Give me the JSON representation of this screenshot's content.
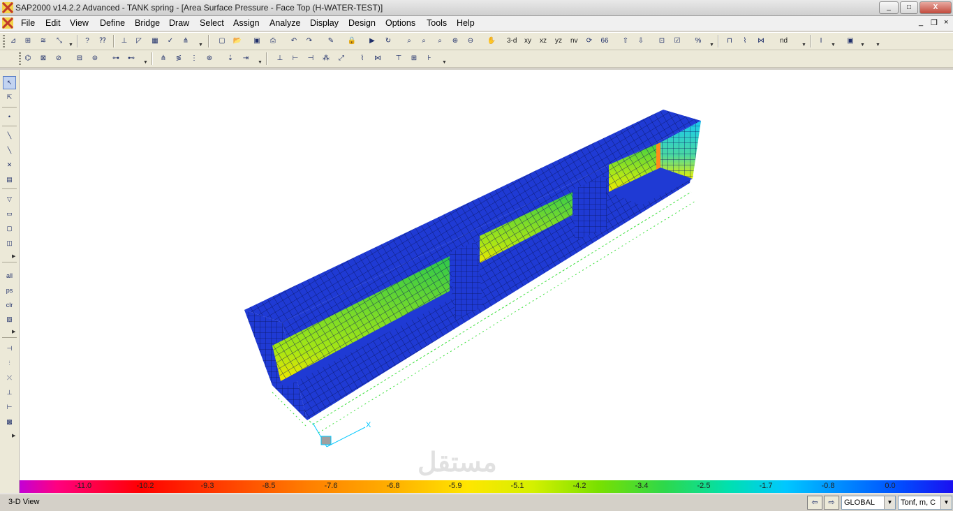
{
  "window": {
    "title": "SAP2000 v14.2.2 Advanced  - TANK spring - [Area Surface Pressure - Face Top (H-WATER-TEST)]",
    "controls": {
      "minimize": "_",
      "maximize": "□",
      "close": "X"
    }
  },
  "menu": {
    "items": [
      "File",
      "Edit",
      "View",
      "Define",
      "Bridge",
      "Draw",
      "Select",
      "Assign",
      "Analyze",
      "Display",
      "Design",
      "Options",
      "Tools",
      "Help"
    ],
    "mdi_controls": {
      "minimize": "_",
      "restore": "❐",
      "close": "×"
    }
  },
  "toolbar": {
    "view_buttons": [
      "3-d",
      "xy",
      "xz",
      "yz",
      "nv"
    ],
    "nd_label": "nd"
  },
  "left_toolbar": {
    "all_label": "all",
    "ps_label": "ps",
    "clr_label": "clr"
  },
  "canvas": {
    "axis_x_label": "X",
    "watermark": "مستقل"
  },
  "legend": {
    "values": [
      "-11.0",
      "-10.2",
      "-9.3",
      "-8.5",
      "-7.6",
      "-6.8",
      "-5.9",
      "-5.1",
      "-4.2",
      "-3.4",
      "-2.5",
      "-1.7",
      "-0.8",
      "0.0"
    ],
    "colors": {
      "min": "#c300d6",
      "max": "#1a10f0",
      "model_surface": "#1e3ad6",
      "supports": "#3de03d"
    }
  },
  "statusbar": {
    "view_name": "3-D View",
    "coord_system": "GLOBAL",
    "units": "Tonf, m, C"
  }
}
